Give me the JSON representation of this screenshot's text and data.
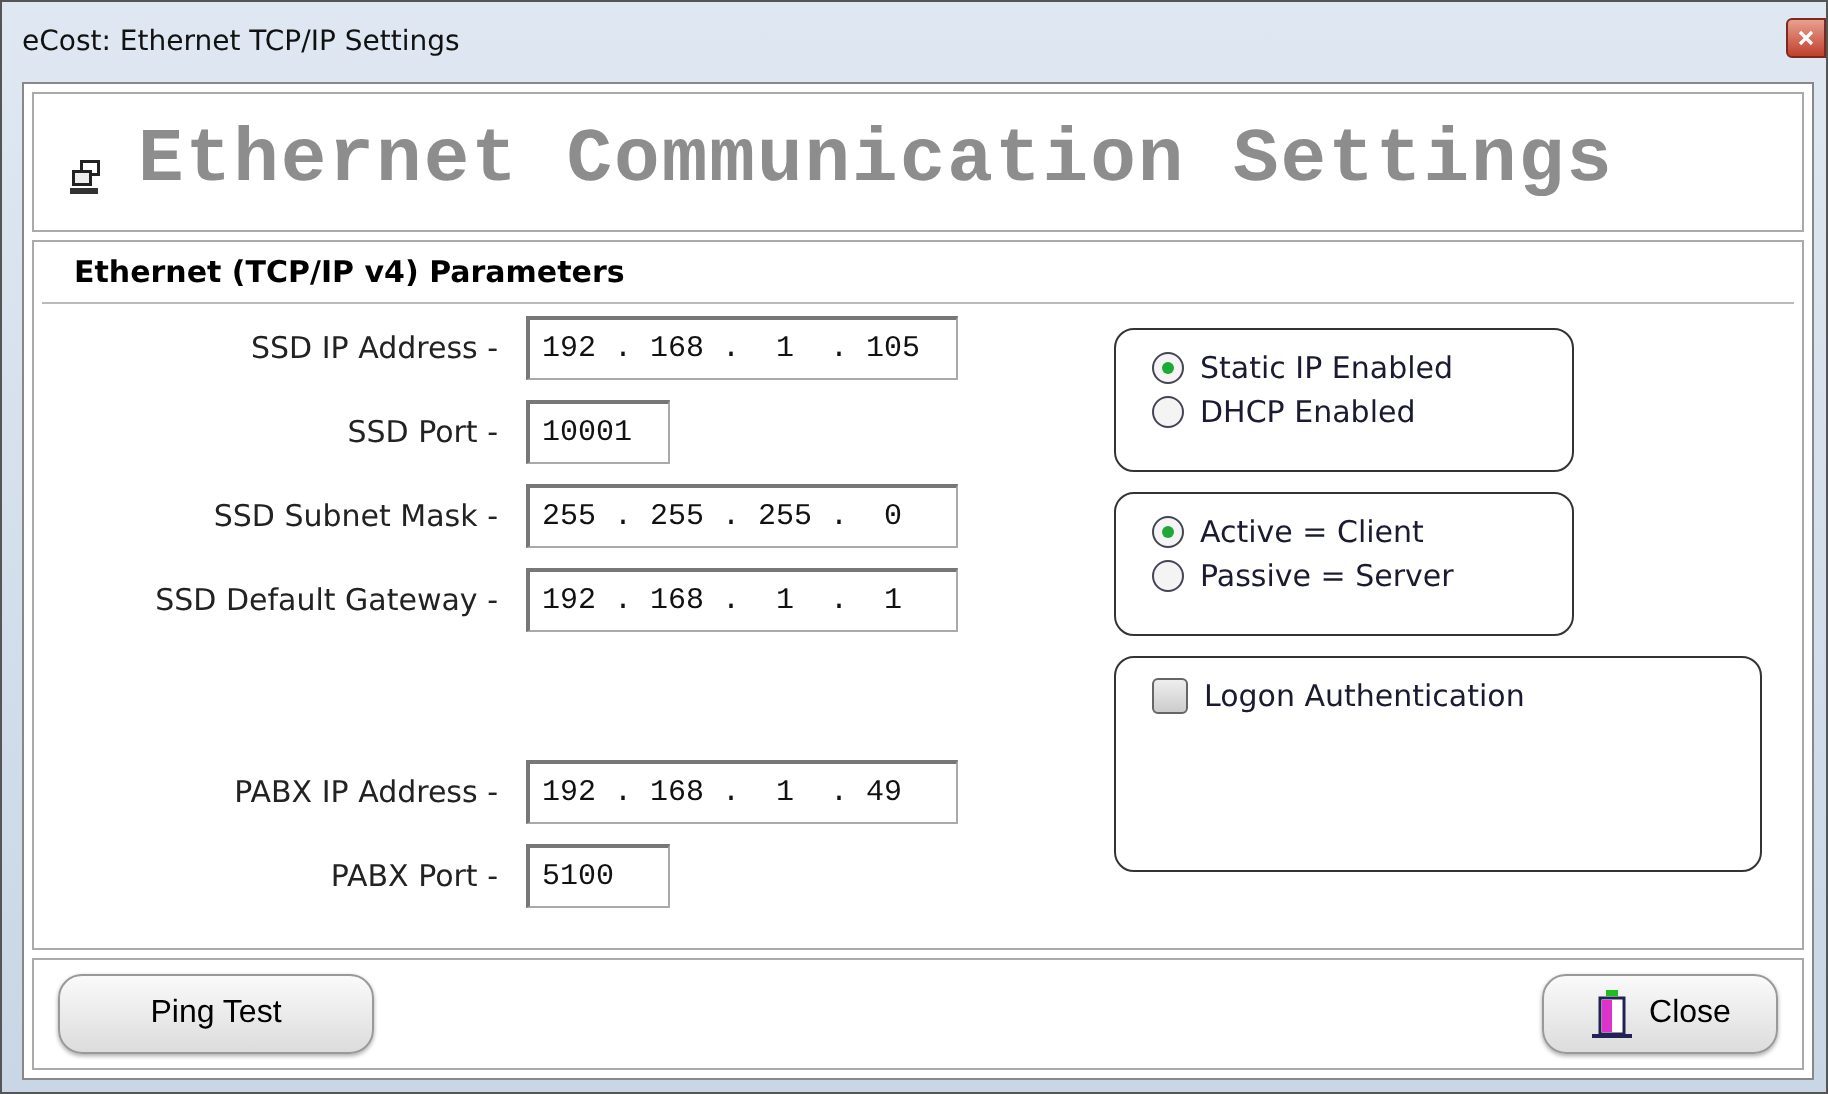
{
  "window": {
    "title": "eCost:  Ethernet TCP/IP Settings"
  },
  "heading": "Ethernet Communication Settings",
  "section": "Ethernet (TCP/IP v4) Parameters",
  "fields": [
    {
      "label": "SSD IP Address -",
      "value": "192 . 168 .  1  . 105",
      "kind": "wide"
    },
    {
      "label": "SSD Port  -",
      "value": "10001",
      "kind": "short"
    },
    {
      "label": "SSD Subnet Mask  -",
      "value": "255 . 255 . 255 .  0",
      "kind": "wide"
    },
    {
      "label": "SSD Default Gateway  -",
      "value": "192 . 168 .  1  .  1",
      "kind": "wide"
    },
    {
      "kind": "gap"
    },
    {
      "label": "PABX IP Address  -",
      "value": "192 . 168 .  1  . 49",
      "kind": "wide"
    },
    {
      "label": "PABX Port  -",
      "value": "5100",
      "kind": "short"
    }
  ],
  "ip_mode": [
    {
      "label": "Static IP Enabled",
      "selected": true
    },
    {
      "label": "DHCP Enabled",
      "selected": false
    }
  ],
  "connection_mode": [
    {
      "label": "Active = Client",
      "selected": true
    },
    {
      "label": "Passive = Server",
      "selected": false
    }
  ],
  "logon_authentication": {
    "label": "Logon Authentication",
    "checked": false
  },
  "buttons": [
    {
      "label": "Ping Test",
      "kind": "plain"
    },
    {
      "label": "Close",
      "kind": "exit"
    }
  ]
}
